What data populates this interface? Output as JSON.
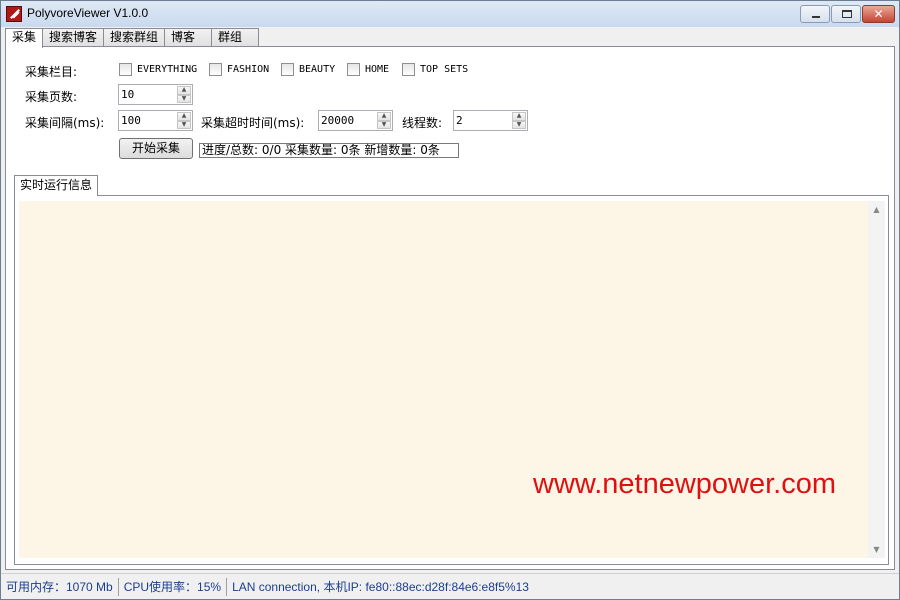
{
  "window": {
    "title": "PolyvoreViewer V1.0.0",
    "close_glyph": "✕"
  },
  "tabs": [
    {
      "label": "采集"
    },
    {
      "label": "搜索博客"
    },
    {
      "label": "搜索群组"
    },
    {
      "label": "博客"
    },
    {
      "label": "群组"
    }
  ],
  "form": {
    "category_label": "采集栏目:",
    "categories": [
      "EVERYTHING",
      "FASHION",
      "BEAUTY",
      "HOME",
      "TOP SETS"
    ],
    "pages_label": "采集页数:",
    "pages_value": "10",
    "interval_label": "采集间隔(ms):",
    "interval_value": "100",
    "timeout_label": "采集超时时间(ms):",
    "timeout_value": "20000",
    "threads_label": "线程数:",
    "threads_value": "2",
    "start_button": "开始采集",
    "progress_text": "进度/总数: 0/0 采集数量: 0条 新增数量: 0条"
  },
  "log": {
    "tab_label": "实时运行信息",
    "watermark": "www.netnewpower.com"
  },
  "status": {
    "memory": "可用内存：1070 Mb",
    "cpu": "CPU使用率：15%",
    "network": "LAN connection,  本机IP: fe80::88ec:d28f:84e6:e8f5%13"
  },
  "icons": [
    "app-icon",
    "minimize-icon",
    "maximize-icon",
    "close-icon",
    "spin-up-icon",
    "spin-down-icon",
    "scroll-up-icon",
    "scroll-down-icon"
  ]
}
